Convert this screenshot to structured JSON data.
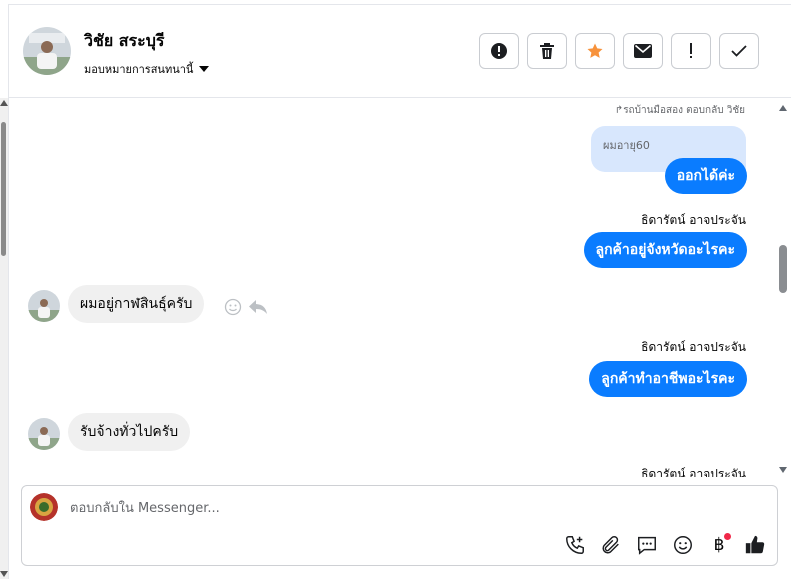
{
  "header": {
    "contact_name": "วิชัย สระบุรี",
    "assign_label": "มอบหมายการสนทนานี้"
  },
  "toolbar": [
    {
      "name": "spam-button",
      "icon": "alert-circle-icon"
    },
    {
      "name": "delete-button",
      "icon": "trash-icon"
    },
    {
      "name": "star-button",
      "icon": "star-icon",
      "color": "#f7923b"
    },
    {
      "name": "mark-unread-button",
      "icon": "envelope-icon"
    },
    {
      "name": "follow-up-button",
      "icon": "exclamation-icon"
    },
    {
      "name": "done-button",
      "icon": "checkmark-icon"
    }
  ],
  "conversation": {
    "reply_note": "รถบ้านมือสอง ตอบกลับ วิชัย",
    "quoted_text": "ผมอายุ60",
    "messages": [
      {
        "direction": "out",
        "text": "ออกได้ค่ะ"
      },
      {
        "direction": "out",
        "sender": "ธิดารัตน์ อาจประจัน",
        "text": "ลูกค้าอยู่จังหวัดอะไรคะ"
      },
      {
        "direction": "in",
        "text": "ผมอยู่กาฬสินธุ์ครับ"
      },
      {
        "direction": "out",
        "sender": "ธิดารัตน์ อาจประจัน",
        "text": "ลูกค้าทำอาชีพอะไรคะ"
      },
      {
        "direction": "in",
        "text": "รับจ้างทั่วไปครับ"
      },
      {
        "direction": "out",
        "sender": "ธิดารัตน์ อาจประจัน"
      }
    ]
  },
  "composer": {
    "placeholder": "ตอบกลับใน Messenger...",
    "value": "",
    "actions": [
      "call-icon",
      "paperclip-icon",
      "chat-bubble-icon",
      "emoji-icon",
      "baht-payment-icon",
      "thumbs-up-icon"
    ],
    "baht_symbol": "฿",
    "accent_color": "#0a7cff"
  }
}
